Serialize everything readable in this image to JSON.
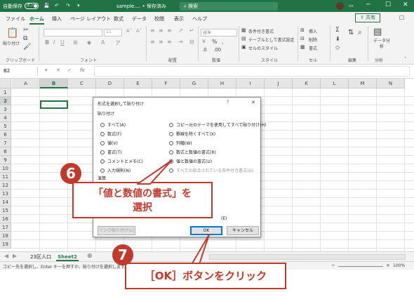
{
  "titlebar": {
    "autosave": "自動保存",
    "toggle": "オン",
    "filename": "sample.... • 保存済み",
    "search": "検索",
    "window_controls": [
      "─",
      "☐",
      "✕"
    ]
  },
  "tabs": [
    "ファイル",
    "ホーム",
    "挿入",
    "ページ レイアウト",
    "数式",
    "データ",
    "校閲",
    "表示",
    "ヘルプ"
  ],
  "share": "共有",
  "ribbon": {
    "clipboard": {
      "paste": "貼り付け",
      "group": "クリップボード"
    },
    "font": {
      "size": "11",
      "group": "フォント"
    },
    "alignment": {
      "group": "配置"
    },
    "number": {
      "format": "標準",
      "group": "数値"
    },
    "styles": {
      "items": [
        "条件付き書式",
        "テーブルとして書式設定",
        "セルのスタイル"
      ],
      "group": "スタイル"
    },
    "cells": {
      "items": [
        "挿入",
        "削除",
        "書式"
      ],
      "group": "セル"
    },
    "editing": {
      "group": "編集"
    },
    "analysis": {
      "label": "データ分析",
      "group": "分析"
    }
  },
  "formula_bar": {
    "name_box": "B2",
    "fx": "fx"
  },
  "columns": [
    "A",
    "B",
    "C",
    "D",
    "E",
    "F",
    "G",
    "H",
    "I",
    "J",
    "K",
    "L",
    "M",
    "N"
  ],
  "rows": [
    "1",
    "2",
    "3",
    "4",
    "5",
    "6",
    "7",
    "8",
    "9",
    "10",
    "11",
    "12",
    "13",
    "14",
    "15",
    "16",
    "17",
    "18",
    "19"
  ],
  "dialog": {
    "title": "形式を選択して貼り付け",
    "help": "?",
    "close": "✕",
    "paste_section": "貼り付け",
    "left_options": [
      "すべて(A)",
      "数式(F)",
      "値(V)",
      "書式(T)",
      "コメントとメモ(C)",
      "入力規則(N)"
    ],
    "right_options": [
      "コピー元のテーマを使用してすべて貼り付け(H)",
      "罫線を除くすべて(X)",
      "列幅(W)",
      "数式と数値の書式(R)",
      "値と数値の書式(U)",
      "すべての結合されている条件付き書式(G)"
    ],
    "selected": "値と数値の書式(U)",
    "operation_section": "演算",
    "transpose_label": "(E)",
    "paste_link_button": "リンク貼り付け(L)",
    "ok_button": "OK",
    "cancel_button": "キャンセル"
  },
  "sheets": [
    "23区人口",
    "Sheet2"
  ],
  "status": {
    "text": "コピー先を選択し、Enter キーを押すか、貼り付けを選択します。",
    "zoom": "100%"
  },
  "annotations": {
    "step6": "6",
    "callout6_line1": "「値と数値の書式」を",
    "callout6_line2": "選択",
    "step7": "7",
    "callout7": "［OK］ボタンをクリック"
  },
  "colors": {
    "excel_green": "#217346",
    "annotation_red": "#c0392b"
  }
}
